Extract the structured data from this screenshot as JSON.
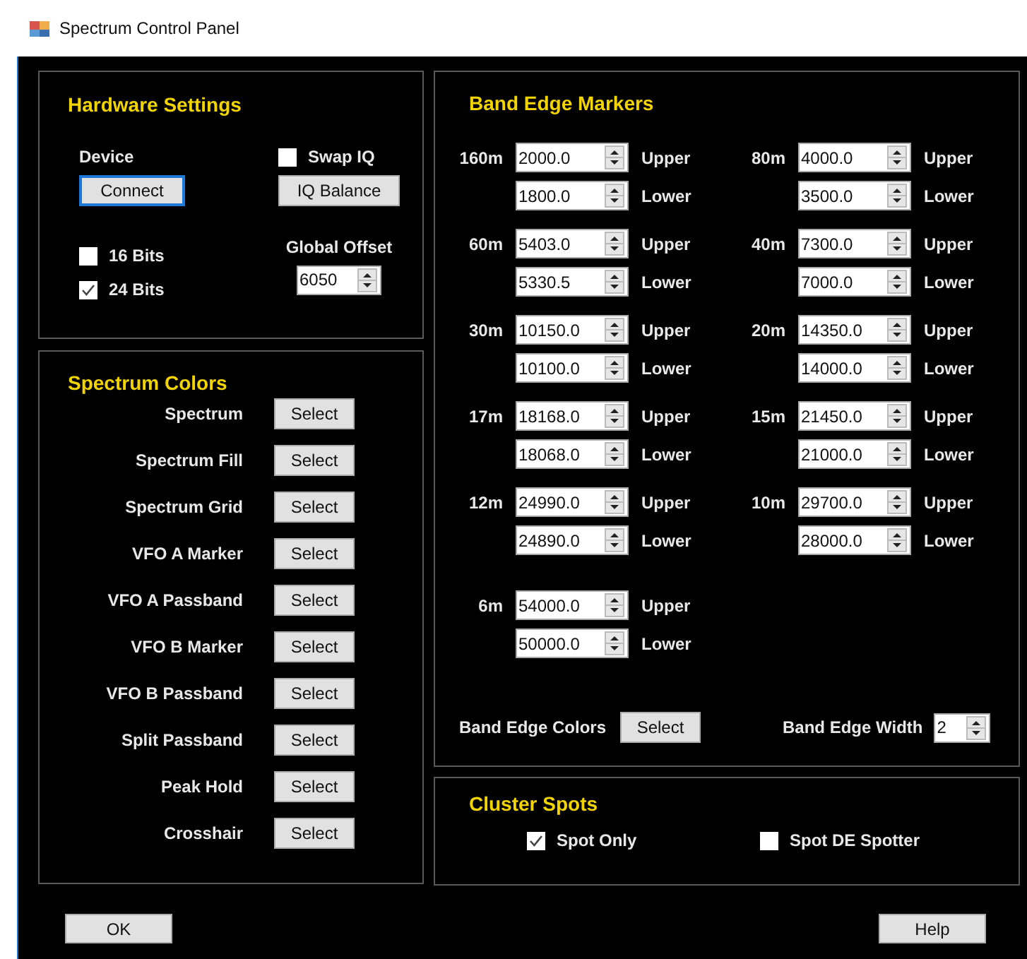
{
  "window": {
    "title": "Spectrum Control Panel"
  },
  "hardware_settings": {
    "title": "Hardware Settings",
    "device_label": "Device",
    "connect_button": "Connect",
    "swap_iq": {
      "label": "Swap IQ",
      "checked": false
    },
    "iq_balance_button": "IQ Balance",
    "bits": [
      {
        "label": "16 Bits",
        "checked": false
      },
      {
        "label": "24 Bits",
        "checked": true
      }
    ],
    "global_offset": {
      "label": "Global Offset",
      "value": "6050"
    }
  },
  "spectrum_colors": {
    "title": "Spectrum Colors",
    "items": [
      {
        "label": "Spectrum",
        "button": "Select"
      },
      {
        "label": "Spectrum Fill",
        "button": "Select"
      },
      {
        "label": "Spectrum Grid",
        "button": "Select"
      },
      {
        "label": "VFO A Marker",
        "button": "Select"
      },
      {
        "label": "VFO A Passband",
        "button": "Select"
      },
      {
        "label": "VFO B Marker",
        "button": "Select"
      },
      {
        "label": "VFO B Passband",
        "button": "Select"
      },
      {
        "label": "Split Passband",
        "button": "Select"
      },
      {
        "label": "Peak Hold",
        "button": "Select"
      },
      {
        "label": "Crosshair",
        "button": "Select"
      }
    ]
  },
  "band_edge_markers": {
    "title": "Band Edge Markers",
    "bands": [
      {
        "name": "160m",
        "upper": "2000.0",
        "upper_label": "Upper",
        "lower": "1800.0",
        "lower_label": "Lower"
      },
      {
        "name": "80m",
        "upper": "4000.0",
        "upper_label": "Upper",
        "lower": "3500.0",
        "lower_label": "Lower"
      },
      {
        "name": "60m",
        "upper": "5403.0",
        "upper_label": "Upper",
        "lower": "5330.5",
        "lower_label": "Lower"
      },
      {
        "name": "40m",
        "upper": "7300.0",
        "upper_label": "Upper",
        "lower": "7000.0",
        "lower_label": "Lower"
      },
      {
        "name": "30m",
        "upper": "10150.0",
        "upper_label": "Upper",
        "lower": "10100.0",
        "lower_label": "Lower"
      },
      {
        "name": "20m",
        "upper": "14350.0",
        "upper_label": "Upper",
        "lower": "14000.0",
        "lower_label": "Lower"
      },
      {
        "name": "17m",
        "upper": "18168.0",
        "upper_label": "Upper",
        "lower": "18068.0",
        "lower_label": "Lower"
      },
      {
        "name": "15m",
        "upper": "21450.0",
        "upper_label": "Upper",
        "lower": "21000.0",
        "lower_label": "Lower"
      },
      {
        "name": "12m",
        "upper": "24990.0",
        "upper_label": "Upper",
        "lower": "24890.0",
        "lower_label": "Lower"
      },
      {
        "name": "10m",
        "upper": "29700.0",
        "upper_label": "Upper",
        "lower": "28000.0",
        "lower_label": "Lower"
      },
      {
        "name": "6m",
        "upper": "54000.0",
        "upper_label": "Upper",
        "lower": "50000.0",
        "lower_label": "Lower"
      }
    ],
    "band_edge_colors": {
      "label": "Band Edge Colors",
      "button": "Select"
    },
    "band_edge_width": {
      "label": "Band Edge Width",
      "value": "2"
    }
  },
  "cluster_spots": {
    "title": "Cluster Spots",
    "options": [
      {
        "label": "Spot Only",
        "checked": true
      },
      {
        "label": "Spot DE Spotter",
        "checked": false
      }
    ]
  },
  "buttons": [
    "OK",
    "Help"
  ]
}
